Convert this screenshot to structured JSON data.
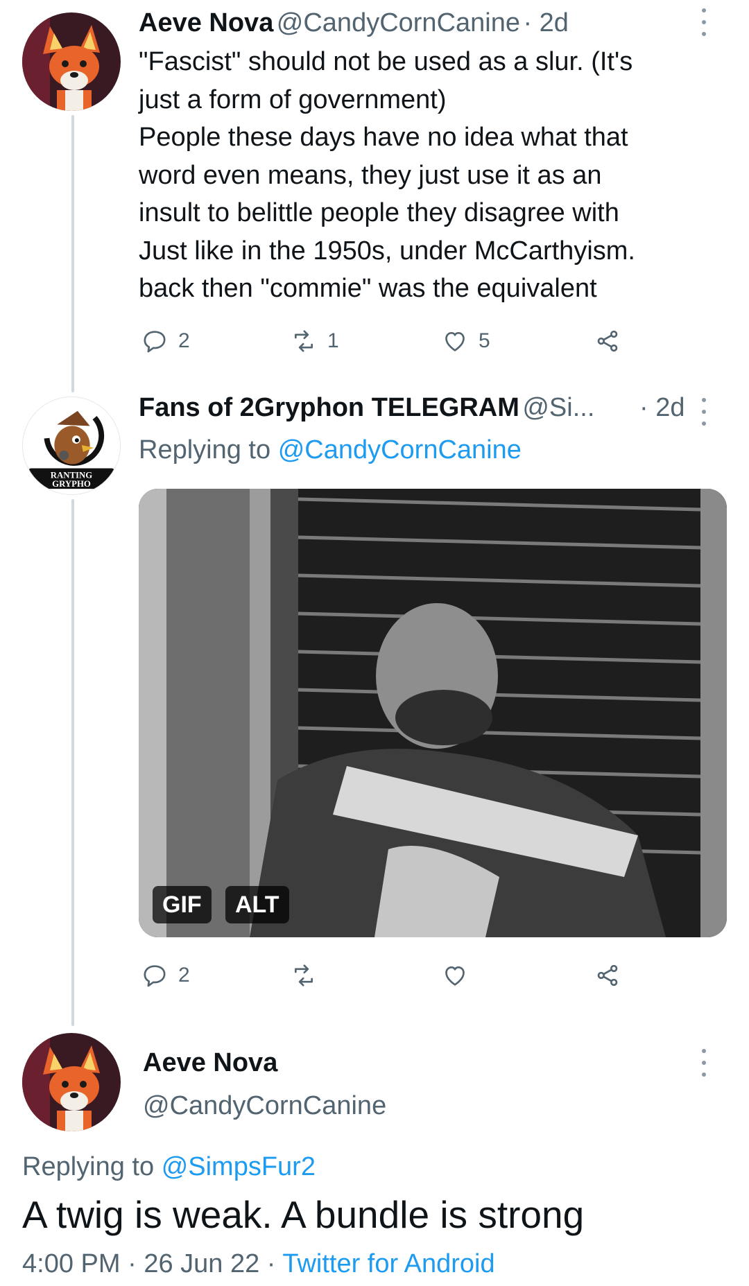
{
  "tweets": [
    {
      "author_name": "Aeve Nova",
      "author_handle": "@CandyCornCanine",
      "age": "· 2d",
      "text": "\"Fascist\" should not be used as a slur. (It's\njust a form of government)\nPeople these days have no idea what that\nword even means, they just use it as an\ninsult to belittle people they disagree with\nJust like in the 1950s, under McCarthyism.\nback then \"commie\" was the equivalent",
      "reply_count": "2",
      "retweet_count": "1",
      "like_count": "5"
    },
    {
      "author_name": "Fans of 2Gryphon TELEGRAM",
      "author_handle": "@Si...",
      "age": "· 2d",
      "replying_label": "Replying to",
      "replying_handle": "@CandyCornCanine",
      "avatar_text_1": "RANTING",
      "avatar_text_2": "GRYPHO",
      "media_badges": [
        "GIF",
        "ALT"
      ],
      "reply_count": "2"
    }
  ],
  "focused_tweet": {
    "author_name": "Aeve Nova",
    "author_handle": "@CandyCornCanine",
    "replying_label": "Replying to",
    "replying_handle": "@SimpsFur2",
    "text": "A twig is weak. A bundle is strong",
    "time": "4:00 PM",
    "sep1": "·",
    "date": "26 Jun 22",
    "sep2": "·",
    "source": "Twitter for Android"
  },
  "icons": [
    "more-icon",
    "reply-icon",
    "retweet-icon",
    "like-icon",
    "share-icon"
  ],
  "colors": {
    "link": "#1d9bf0",
    "secondary_text": "#536471",
    "thread_line": "#cfd9de"
  }
}
